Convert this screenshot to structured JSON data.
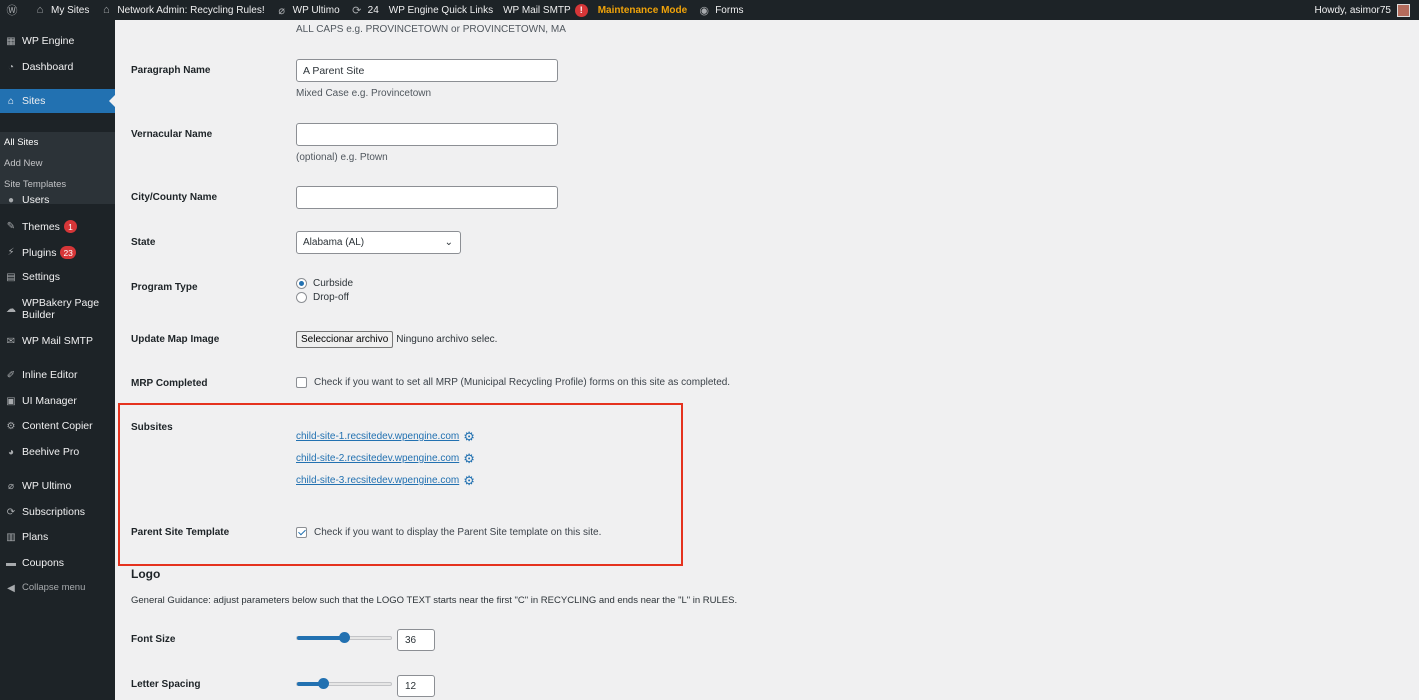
{
  "adminbar": {
    "my_sites": "My Sites",
    "network_admin": "Network Admin: Recycling Rules!",
    "wp_ultimo": "WP Ultimo",
    "updates_count": "24",
    "quick_links": "WP Engine Quick Links",
    "wp_mail_smtp": "WP Mail SMTP",
    "wp_mail_smtp_badge": "!",
    "maintenance": "Maintenance Mode",
    "forms": "Forms",
    "howdy": "Howdy, asimor75"
  },
  "sidebar": {
    "wp_engine": "WP Engine",
    "dashboard": "Dashboard",
    "sites": "Sites",
    "all_sites": "All Sites",
    "add_new": "Add New",
    "site_templates": "Site Templates",
    "users": "Users",
    "themes": "Themes",
    "themes_badge": "1",
    "plugins": "Plugins",
    "plugins_badge": "23",
    "settings": "Settings",
    "wpbakery": "WPBakery Page Builder",
    "wp_mail_smtp": "WP Mail SMTP",
    "inline_editor": "Inline Editor",
    "ui_manager": "UI Manager",
    "content_copier": "Content Copier",
    "beehive": "Beehive Pro",
    "wp_ultimo": "WP Ultimo",
    "subscriptions": "Subscriptions",
    "plans": "Plans",
    "coupons": "Coupons",
    "collapse": "Collapse menu"
  },
  "form": {
    "top_desc": "ALL CAPS e.g. PROVINCETOWN or PROVINCETOWN, MA",
    "paragraph_name_label": "Paragraph Name",
    "paragraph_name_value": "A Parent Site",
    "paragraph_name_desc": "Mixed Case e.g. Provincetown",
    "vernacular_label": "Vernacular Name",
    "vernacular_value": "",
    "vernacular_desc": "(optional) e.g. Ptown",
    "city_label": "City/County Name",
    "city_value": "",
    "state_label": "State",
    "state_value": "Alabama (AL)",
    "program_type_label": "Program Type",
    "program_curbside": "Curbside",
    "program_dropoff": "Drop-off",
    "map_label": "Update Map Image",
    "file_button": "Seleccionar archivo",
    "file_status": "Ninguno archivo selec.",
    "mrp_label": "MRP Completed",
    "mrp_desc": "Check if you want to set all MRP (Municipal Recycling Profile) forms on this site as completed.",
    "subsites_label": "Subsites",
    "subsites": [
      "child-site-1.recsitedev.wpengine.com",
      "child-site-2.recsitedev.wpengine.com",
      "child-site-3.recsitedev.wpengine.com"
    ],
    "parent_template_label": "Parent Site Template",
    "parent_template_desc": "Check if you want to display the Parent Site template on this site."
  },
  "logo": {
    "title": "Logo",
    "guidance": "General Guidance: adjust parameters below such that the LOGO TEXT starts near the first \"C\" in RECYCLING and ends near the \"L\" in RULES.",
    "font_size_label": "Font Size",
    "font_size_value": "36",
    "font_size_fraction": 0.5,
    "letter_spacing_label": "Letter Spacing",
    "letter_spacing_value": "12",
    "letter_spacing_fraction": 0.25
  },
  "colors": {
    "admin_dark": "#1d2327",
    "accent": "#2271b1",
    "badge": "#d63638",
    "maintenance": "#f0a30a",
    "highlight": "#e5321e"
  }
}
